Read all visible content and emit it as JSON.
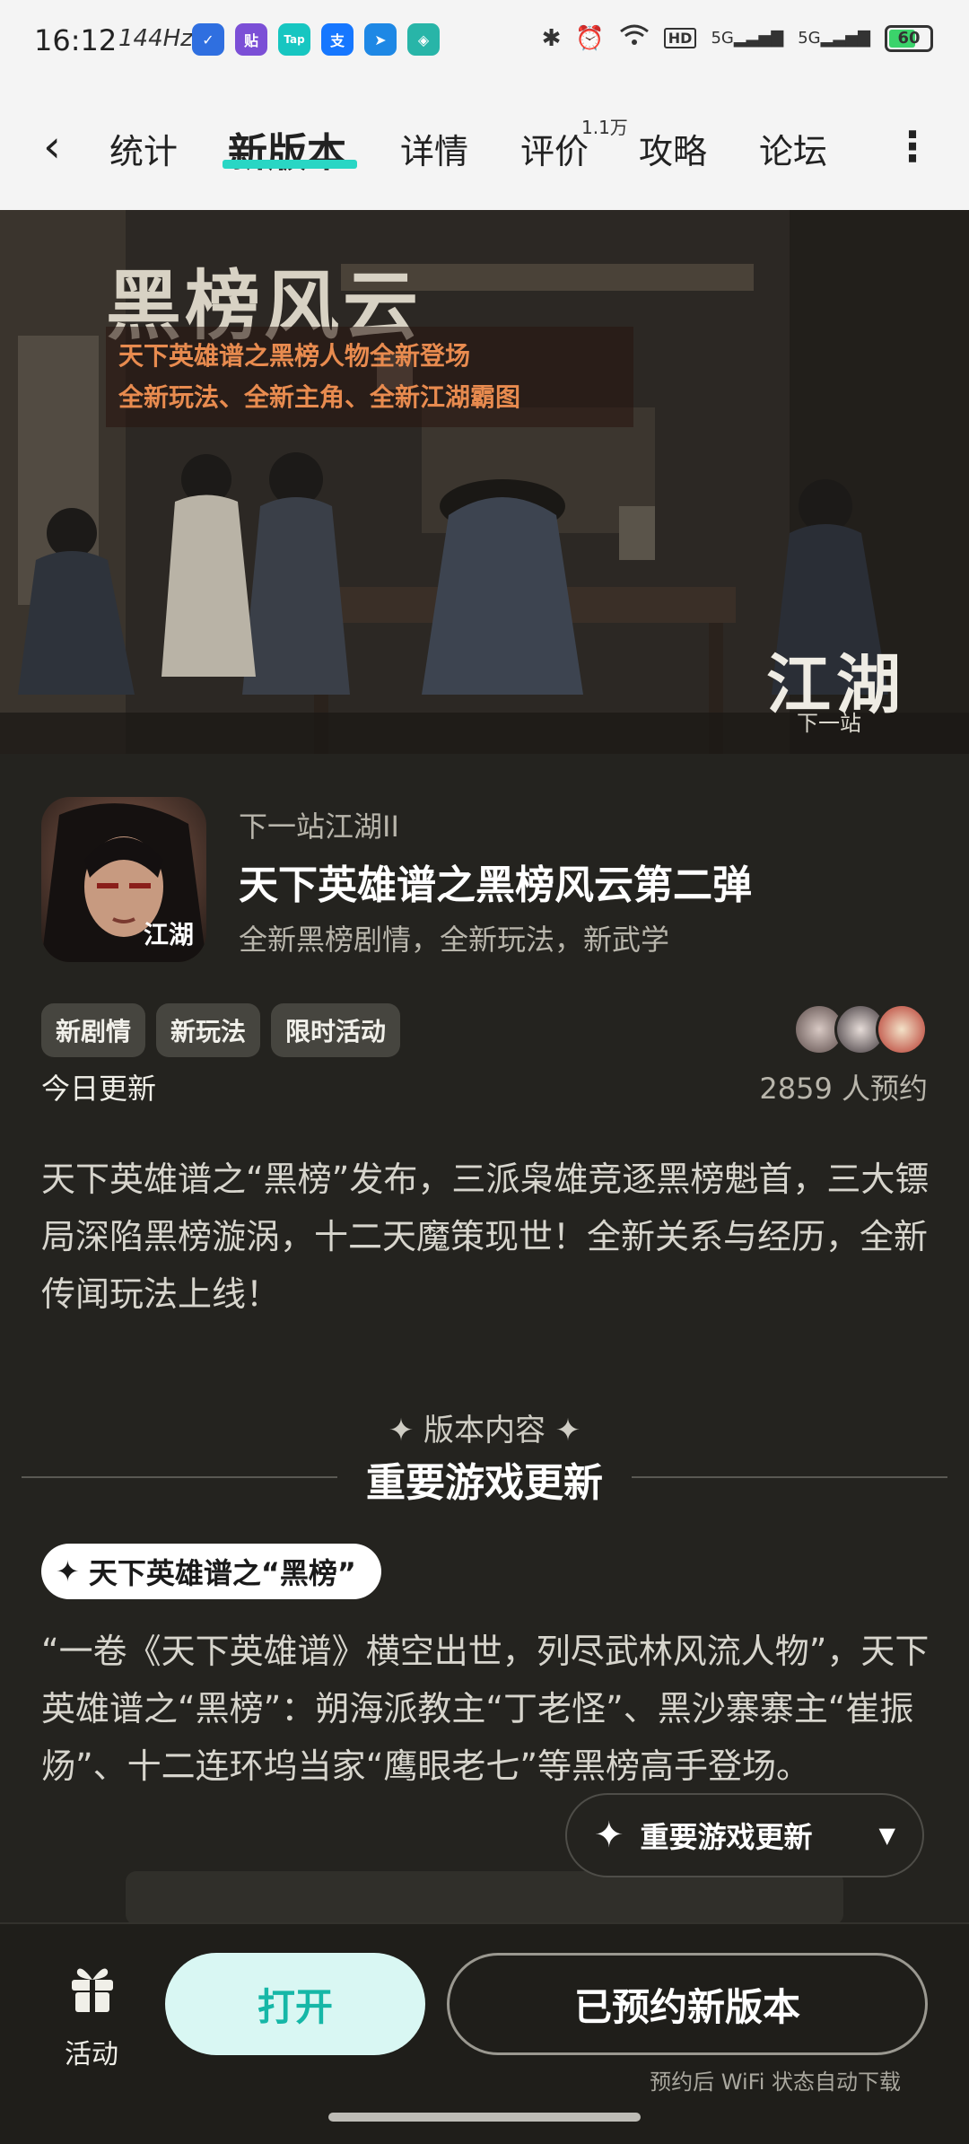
{
  "status_bar": {
    "time": "16:12",
    "refresh": "144Hz",
    "app_icons": [
      {
        "name": "shield-app-icon",
        "color": "#2f6fe0",
        "glyph": "✓"
      },
      {
        "name": "tie-app-icon",
        "color": "#7b4fd6",
        "glyph": "贴"
      },
      {
        "name": "taptap-app-icon",
        "color": "#17c6c1",
        "glyph": "Tap"
      },
      {
        "name": "alipay-app-icon",
        "color": "#1677ff",
        "glyph": "支"
      },
      {
        "name": "cursor-app-icon",
        "color": "#1e88e5",
        "glyph": "➤"
      },
      {
        "name": "security-app-icon",
        "color": "#28b5a8",
        "glyph": "◈"
      }
    ],
    "network_1": "5G",
    "network_2": "5G",
    "battery": "60"
  },
  "nav": {
    "tabs": [
      {
        "label": "统计"
      },
      {
        "label": "新版本"
      },
      {
        "label": "详情"
      },
      {
        "label": "评价"
      },
      {
        "label": "攻略"
      },
      {
        "label": "论坛"
      }
    ],
    "review_count": "1.1万",
    "active_tab": "新版本",
    "accent": "#29d6c4"
  },
  "hero": {
    "title": "黑榜风云",
    "subtitle_line1": "天下英雄谱之黑榜人物全新登场",
    "subtitle_line2": "全新玩法、全新主角、全新江湖霸图",
    "logo": "江湖",
    "logo_sub": "下一站"
  },
  "game": {
    "name": "下一站江湖II",
    "title": "天下英雄谱之黑榜风云第二弹",
    "description": "全新黑榜剧情，全新玩法，新武学",
    "icon_text": "江湖"
  },
  "tags": [
    "新剧情",
    "新玩法",
    "限时活动"
  ],
  "update_label": "今日更新",
  "reservations": "2859 人预约",
  "summary": "天下英雄谱之“黑榜”发布，三派枭雄竞逐黑榜魁首，三大镖局深陷黑榜漩涡，十二天魔策现世！全新关系与经历，全新传闻玩法上线！",
  "section": {
    "kicker": "✦ 版本内容 ✦",
    "title": "重要游戏更新",
    "pill_label": "天下英雄谱之“黑榜”",
    "body": "“一卷《天下英雄谱》横空出世，列尽武林风流人物”，天下英雄谱之“黑榜”：朔海派教主“丁老怪”、黑沙寨寨主“崔振炀”、十二连环坞当家“鹰眼老七”等黑榜高手登场。"
  },
  "floating_nav": {
    "label": "重要游戏更新"
  },
  "bottom_bar": {
    "activity_label": "活动",
    "open_label": "打开",
    "reserved_label": "已预约新版本",
    "hint": "预约后 WiFi 状态自动下载"
  }
}
